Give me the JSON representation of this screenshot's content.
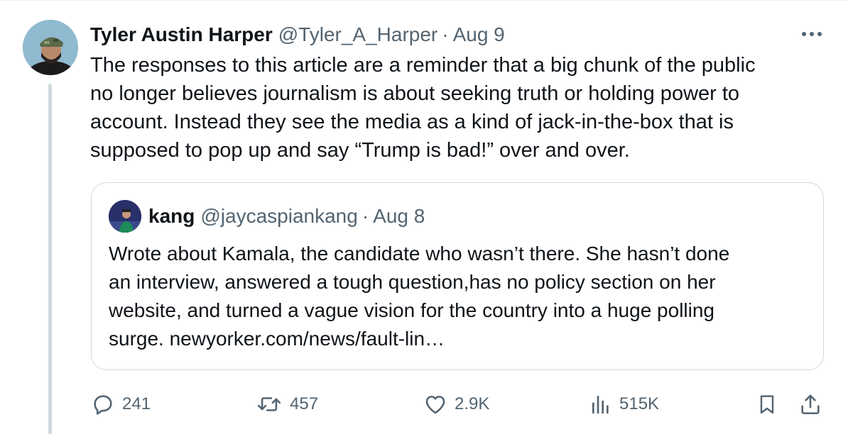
{
  "tweet": {
    "author_name": "Tyler Austin Harper",
    "author_handle": "@Tyler_A_Harper",
    "separator": "·",
    "date": "Aug 9",
    "text_lines": [
      "The responses to this article are a reminder that a big chunk of the public",
      "no longer believes journalism is about seeking truth or holding power to",
      "account. Instead they see the media as a kind of jack-in-the-box that is",
      "supposed to pop up and say “Trump is bad!” over and over."
    ]
  },
  "quote": {
    "author_name": "kang",
    "author_handle": "@jaycaspiankang",
    "separator": "·",
    "date": "Aug 8",
    "text_lines": [
      "Wrote about Kamala, the candidate who wasn’t there. She hasn’t done",
      "an interview, answered a tough question,has no policy section on her",
      "website, and turned a vague vision for the country into a huge polling",
      "surge. newyorker.com/news/fault-lin…"
    ]
  },
  "actions": {
    "replies": "241",
    "reposts": "457",
    "likes": "2.9K",
    "views": "515K"
  },
  "icons": {
    "more": "more-icon",
    "reply": "reply-icon",
    "repost": "repost-icon",
    "like": "heart-icon",
    "views": "views-icon",
    "bookmark": "bookmark-icon",
    "share": "share-icon"
  },
  "colors": {
    "text": "#0f1419",
    "secondary": "#536471",
    "border": "#cfd9de"
  }
}
